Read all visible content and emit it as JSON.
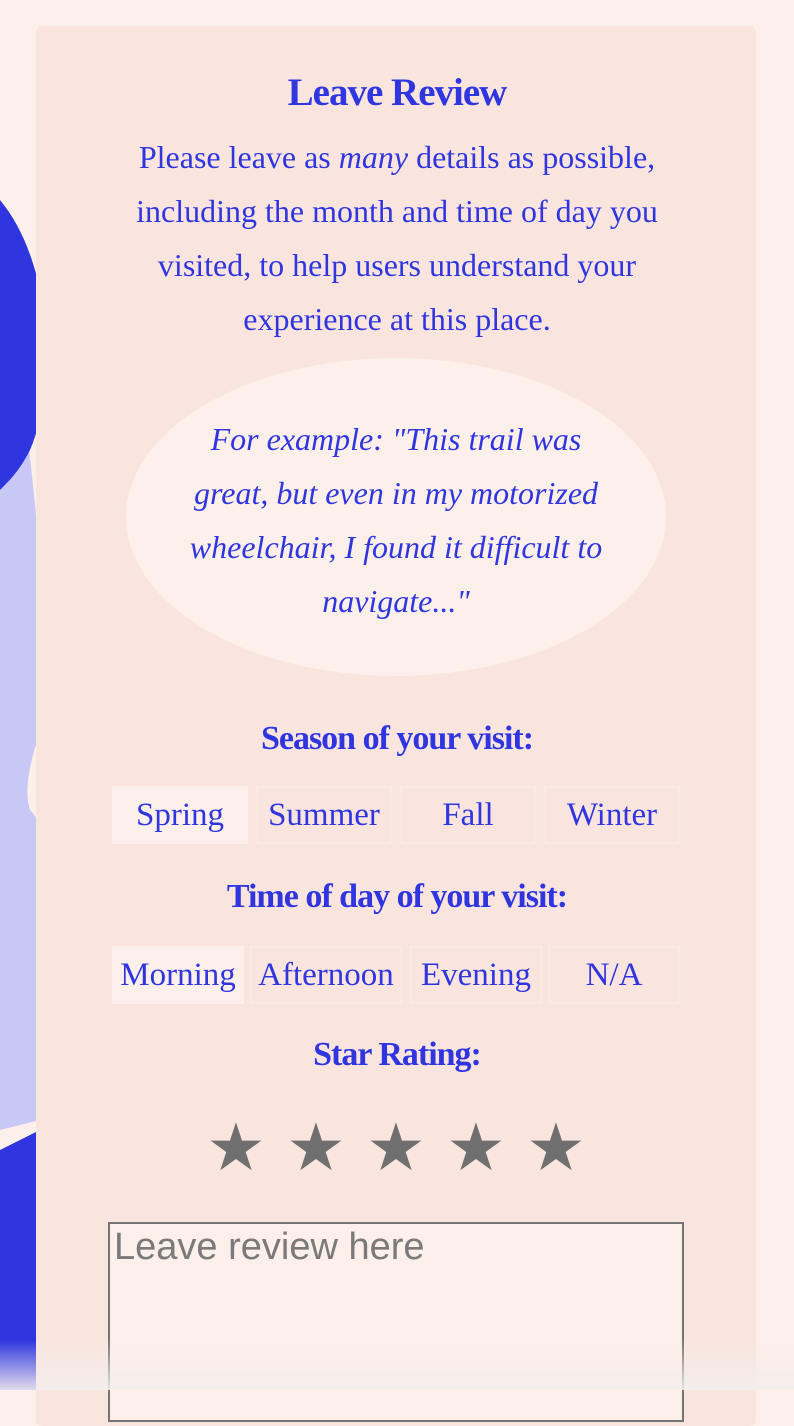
{
  "colors": {
    "accent": "#2f36e0",
    "page_background": "#fdefe9",
    "card_background": "#f9e5de",
    "decor_light": "#c8c8f7",
    "star_empty": "#6f6f6f"
  },
  "review_form": {
    "title": "Leave Review",
    "intro_before": "Please leave as ",
    "intro_emphasis": "many",
    "intro_after": " details as possible, including the month and time of day you visited, to help users understand your experience at this place.",
    "example": "For example: \"This trail was great, but even in my motorized wheelchair, I found it difficult to navigate...\"",
    "season": {
      "label": "Season of your visit:",
      "options": [
        "Spring",
        "Summer",
        "Fall",
        "Winter"
      ],
      "selected": "Spring"
    },
    "time_of_day": {
      "label": "Time of day of your visit:",
      "options": [
        "Morning",
        "Afternoon",
        "Evening",
        "N/A"
      ],
      "selected": "Morning"
    },
    "rating": {
      "label": "Star Rating:",
      "max": 5,
      "value": 0,
      "star_icon": "star-icon"
    },
    "review_input": {
      "placeholder": "Leave review here",
      "value": ""
    }
  }
}
